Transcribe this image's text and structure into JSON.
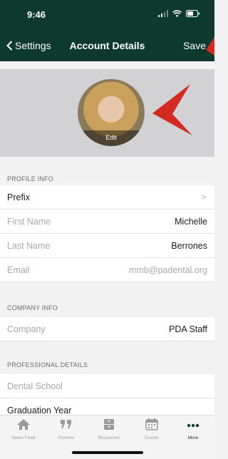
{
  "status_bar": {
    "time": "9:46"
  },
  "nav": {
    "back_label": "Settings",
    "title": "Account Details",
    "save_label": "Save"
  },
  "profile": {
    "edit_label": "Edit"
  },
  "sections": {
    "profile_info": {
      "header": "PROFILE INFO",
      "prefix_label": "Prefix",
      "first_name_label": "First Name",
      "first_name_value": "Michelle",
      "last_name_label": "Last Name",
      "last_name_value": "Berrones",
      "email_label": "Email",
      "email_value": "mmb@padental.org"
    },
    "company_info": {
      "header": "COMPANY INFO",
      "company_label": "Company",
      "company_value": "PDA Staff"
    },
    "professional_details": {
      "header": "PROFESSIONAL DETAILS",
      "dental_school_label": "Dental School",
      "graduation_year_label": "Graduation Year"
    }
  },
  "tabs": [
    {
      "label": "News Feed",
      "icon": "home-icon"
    },
    {
      "label": "Forums",
      "icon": "quote-icon"
    },
    {
      "label": "Resources",
      "icon": "archive-icon"
    },
    {
      "label": "Events",
      "icon": "calendar-icon"
    },
    {
      "label": "More",
      "icon": "more-icon"
    }
  ],
  "colors": {
    "nav_background": "#0e3a2d",
    "annotation_arrow": "#d42a23",
    "active_tab": "#0e3a2d"
  }
}
